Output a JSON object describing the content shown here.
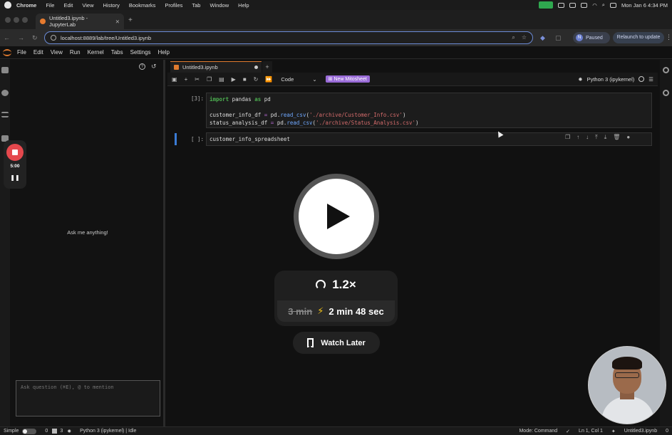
{
  "menubar": {
    "app": "Chrome",
    "items": [
      "File",
      "Edit",
      "View",
      "History",
      "Bookmarks",
      "Profiles",
      "Tab",
      "Window",
      "Help"
    ],
    "datetime": "Mon Jan 6  4:34 PM"
  },
  "chrome": {
    "tab_title": "Untitled3.ipynb - JupyterLab",
    "url": "localhost:8889/lab/tree/Untitled3.ipynb",
    "profile_initial": "N",
    "profile_status": "Paused",
    "relaunch_label": "Relaunch to update"
  },
  "jupyter_menu": [
    "File",
    "Edit",
    "View",
    "Run",
    "Kernel",
    "Tabs",
    "Settings",
    "Help"
  ],
  "side_panel": {
    "prompt": "Ask me anything!",
    "input_placeholder": "Ask question (⌘E), @ to mention"
  },
  "recorder": {
    "time": "5:00"
  },
  "notebook": {
    "tab_title": "Untitled3.ipynb",
    "cell_type": "Code",
    "mito_label": "New Mitosheet",
    "kernel": "Python 3 (ipykernel)",
    "cells": [
      {
        "prompt": "[3]:",
        "lines": [
          "import pandas as pd",
          "",
          "customer_info_df = pd.read_csv('./archive/Customer_Info.csv')",
          "status_analysis_df = pd.read_csv('./archive/Status_Analysis.csv')"
        ]
      },
      {
        "prompt": "[ ]:",
        "lines": [
          "customer_info_spreadsheet"
        ]
      }
    ]
  },
  "player": {
    "speed": "1.2×",
    "original_time": "3 min",
    "new_time": "2 min 48 sec",
    "watch_later": "Watch Later"
  },
  "status_bar": {
    "mode_label": "Simple",
    "count_a": "0",
    "count_b": "3",
    "kernel_status": "Python 3 (ipykernel) | Idle",
    "mode": "Mode: Command",
    "position": "Ln 1, Col 1",
    "file": "Untitled3.ipynb",
    "notifications": "0"
  },
  "colors": {
    "accent": "#e07b2f",
    "active_cell": "#3a7bd5",
    "record": "#e5484d",
    "mito": "#9a6cd8",
    "bolt": "#f5c518"
  }
}
